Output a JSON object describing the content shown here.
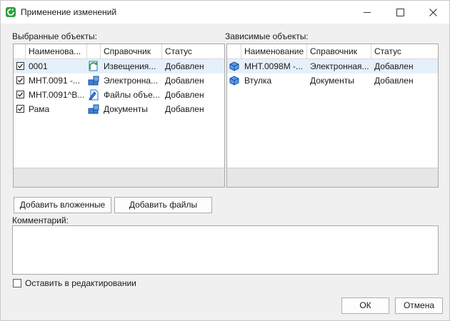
{
  "window": {
    "title": "Применение изменений"
  },
  "selected": {
    "label": "Выбранные объекты:",
    "columns": [
      "Наименова...",
      "Справочник",
      "Статус"
    ],
    "rows": [
      {
        "checked": true,
        "name": "0001",
        "icon": "notice-icon",
        "catalog": "Извещения...",
        "status": "Добавлен",
        "selected": true
      },
      {
        "checked": true,
        "name": "МНТ.0091 -...",
        "icon": "electronic-structure-icon",
        "catalog": "Электронна...",
        "status": "Добавлен",
        "selected": false
      },
      {
        "checked": true,
        "name": "МНТ.0091^В...",
        "icon": "file-object-icon",
        "catalog": "Файлы объе...",
        "status": "Добавлен",
        "selected": false
      },
      {
        "checked": true,
        "name": "Рама",
        "icon": "document-icon",
        "catalog": "Документы",
        "status": "Добавлен",
        "selected": false
      }
    ]
  },
  "dependent": {
    "label": "Зависимые объекты:",
    "columns": [
      "Наименование",
      "Справочник",
      "Статус"
    ],
    "rows": [
      {
        "name": "МНТ.0098М -...",
        "icon": "part-icon",
        "catalog": "Электронная...",
        "status": "Добавлен",
        "selected": true
      },
      {
        "name": "Втулка",
        "icon": "part-icon",
        "catalog": "Документы",
        "status": "Добавлен",
        "selected": false
      }
    ]
  },
  "buttons": {
    "add_nested": "Добавить вложенные",
    "add_files": "Добавить файлы",
    "ok": "ОК",
    "cancel": "Отмена"
  },
  "comment": {
    "label": "Комментарий:",
    "value": ""
  },
  "keep_editing": {
    "label": "Оставить в редактировании",
    "checked": false
  },
  "colors": {
    "selection": "#e5f0fb",
    "accent": "#1f6fd6",
    "app_icon": "#2e9e3e"
  }
}
